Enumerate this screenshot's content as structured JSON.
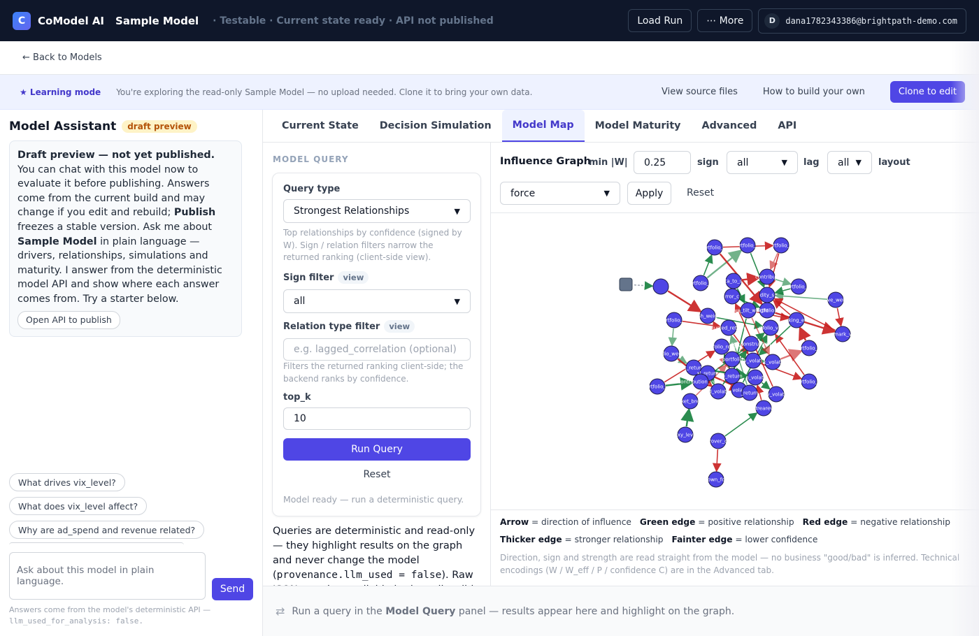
{
  "header": {
    "logo_letter": "C",
    "brand": "CoModel AI",
    "model_name": "Sample Model",
    "status": "· Testable · Current state ready · API not published",
    "load_run": "Load Run",
    "more": "⋯ More",
    "user_initial": "D",
    "user_email": "dana1782343386@brightpath-demo.com"
  },
  "nav": {
    "back": "← Back to Models"
  },
  "banner": {
    "tag": "★ Learning mode",
    "text": "You're exploring the read-only Sample Model — no upload needed. Clone it to bring your own data.",
    "view_source": "View source files",
    "how_to": "How to build your own",
    "clone": "Clone to edit"
  },
  "assistant": {
    "title": "Model Assistant",
    "badge": "draft preview",
    "card": {
      "bold1": "Draft preview — not yet published.",
      "text1": " You can chat with this model now to evaluate it before publishing. Answers come from the current build and may change if you edit and rebuild; ",
      "bold2": "Publish",
      "text2": " freezes a stable version. Ask me about ",
      "bold3": "Sample Model",
      "text3": " in plain language — drivers, relationships, simulations and maturity. I answer from the deterministic model API and show where each answer comes from. Try a starter below.",
      "open_api": "Open API to publish"
    },
    "starters": [
      "What drives vix_level?",
      "What does vix_level affect?",
      "Why are ad_spend and revenue related?"
    ],
    "input_placeholder": "Ask about this model in plain language.",
    "send": "Send",
    "footer_text": "Answers come from the model's deterministic API — ",
    "footer_code": "llm_used_for_analysis: false."
  },
  "tabs": [
    {
      "label": "Current State",
      "active": false
    },
    {
      "label": "Decision Simulation",
      "active": false
    },
    {
      "label": "Model Map",
      "active": true
    },
    {
      "label": "Model Maturity",
      "active": false
    },
    {
      "label": "Advanced",
      "active": false
    },
    {
      "label": "API",
      "active": false
    }
  ],
  "model_query": {
    "title": "MODEL QUERY",
    "query_type_label": "Query type",
    "query_type_value": "Strongest Relationships",
    "query_help": "Top relationships by confidence (signed by W). Sign / relation filters narrow the returned ranking (client-side view).",
    "sign_label": "Sign filter",
    "view_chip": "view",
    "sign_value": "all",
    "relation_label": "Relation type filter",
    "relation_placeholder": "e.g. lagged_correlation (optional)",
    "relation_help": "Filters the returned ranking client-side; the backend ranks by confidence.",
    "topk_label": "top_k",
    "topk_value": "10",
    "run": "Run Query",
    "reset": "Reset",
    "ready": "Model ready — run a deterministic query.",
    "note_a": "Queries are deterministic and read-only — they highlight results on the graph and never change the model (",
    "note_code": "provenance.llm_used = false",
    "note_b": "). Raw JSON remains available in the collapsible section."
  },
  "graph": {
    "title": "Influence Graph",
    "min_w_label": "min |W|",
    "min_w_value": "0.25",
    "sign_label": "sign",
    "sign_value": "all",
    "lag_label": "lag",
    "lag_value": "all",
    "layout_label": "layout",
    "layout_value": "force",
    "apply": "Apply",
    "reset": "Reset",
    "colors": {
      "node": "#4f46e5",
      "positive": "#15803d",
      "negative": "#c81e1e"
    },
    "node_labels": [
      "rtfolio_",
      "rtfolio_",
      "rtfolio_",
      "rtfolio_",
      "rtfolio_",
      "ta_to_s",
      "contributi",
      "rror_c",
      "dity_s",
      "ve_wei",
      "rtfolio",
      "sh_weig",
      "ssive_tilt_weight",
      "justed_return",
      "rtfolio_vol",
      "king_e",
      "mark_v",
      "rtfolio_",
      "ret_construction",
      "portfolio_return",
      "rtfolio_weight",
      "ructed_portfolio_return",
      "k_return",
      "y_volati",
      "xl_return",
      "k_volati",
      "contribution_volati",
      "u_return",
      "n_volati",
      "rtfolio_",
      "ket_bre",
      "d_volati",
      "volati",
      "_return",
      "ctrearevi",
      "y_volati",
      "rtfolio_",
      "rtfolio_",
      "xy_lev",
      "rover_c",
      "known_folio"
    ]
  },
  "legend": {
    "arrow_b": "Arrow",
    "arrow_t": "= direction of influence",
    "green_b": "Green edge",
    "green_t": "= positive relationship",
    "red_b": "Red edge",
    "red_t": "= negative relationship",
    "thick_b": "Thicker edge",
    "thick_t": "= stronger relationship",
    "faint_b": "Fainter edge",
    "faint_t": "= lower confidence",
    "note": "Direction, sign and strength are read straight from the model — no business \"good/bad\" is inferred. Technical encodings (W / W_eff / P / confidence C) are in the Advanced tab."
  },
  "result_bar": {
    "icon": "⇄",
    "text_a": "Run a query in the ",
    "text_b": "Model Query",
    "text_c": " panel — results appear here and highlight on the graph."
  }
}
